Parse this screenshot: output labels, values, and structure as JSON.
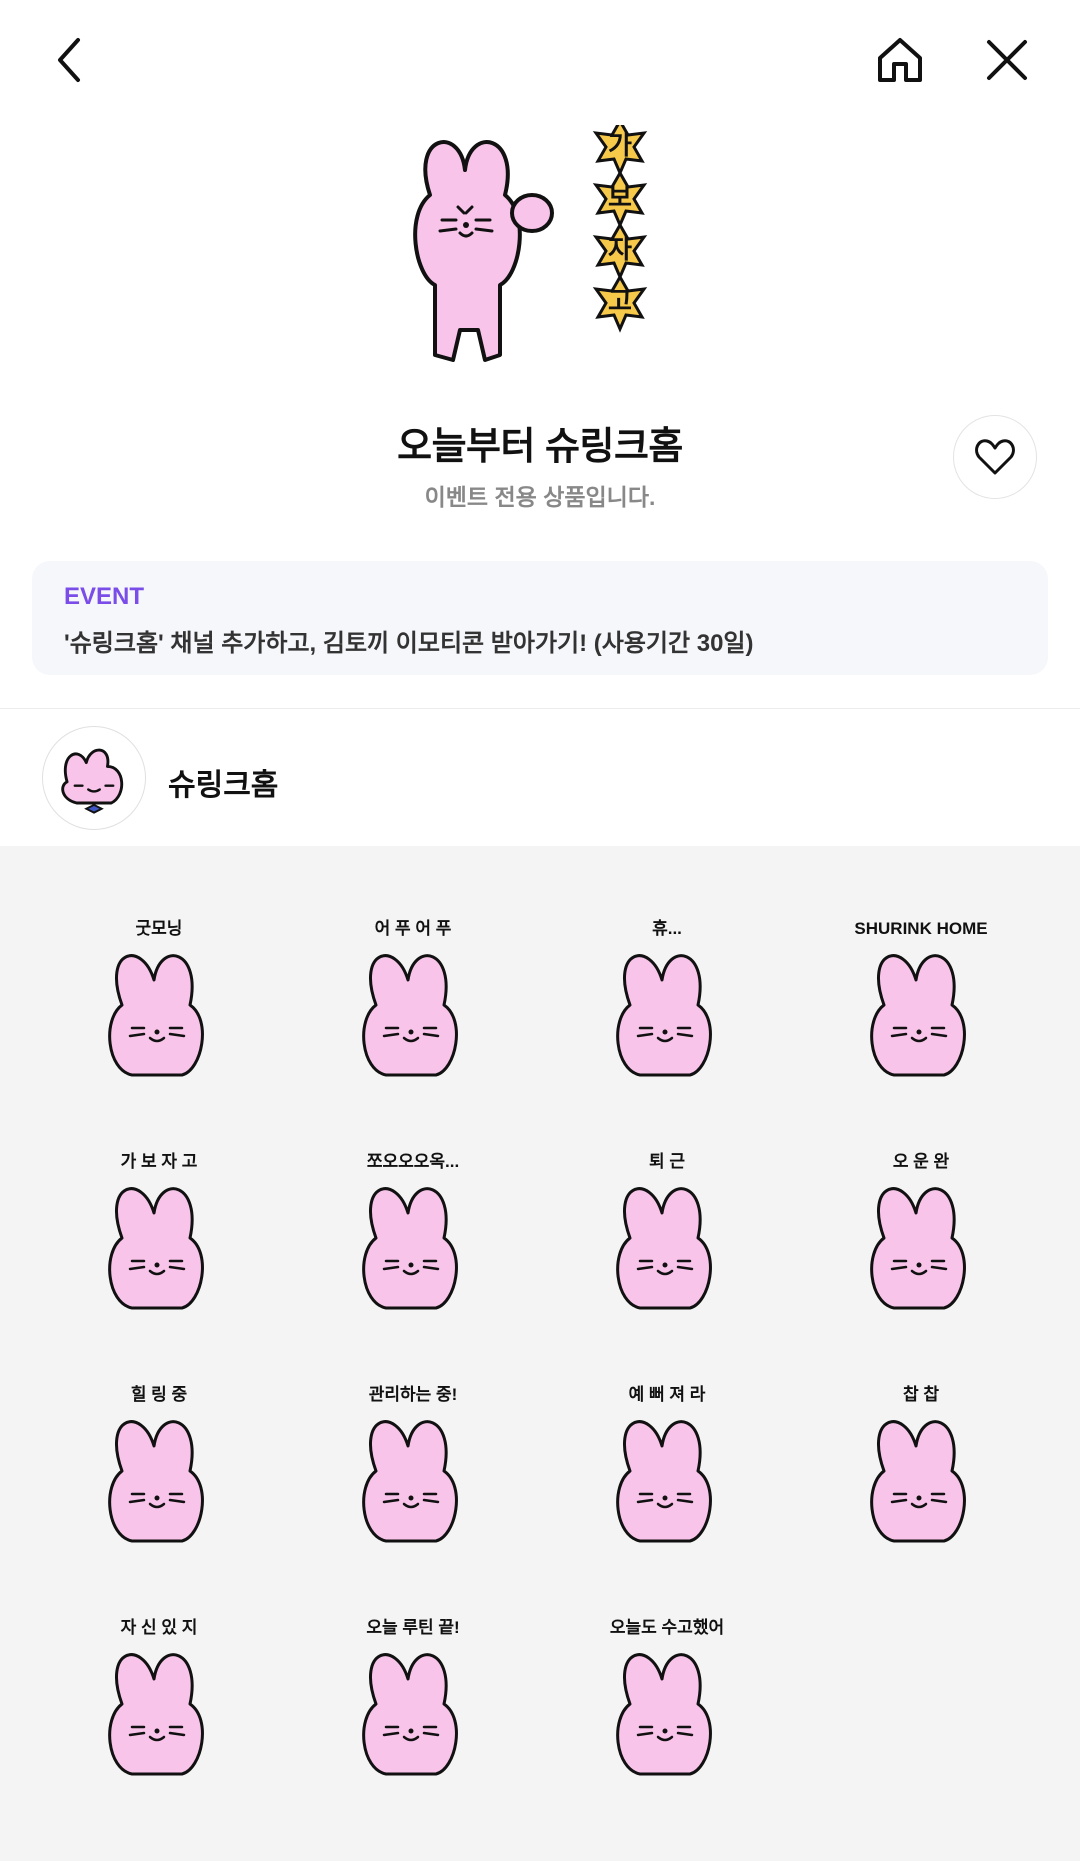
{
  "header": {
    "back_icon": "chevron-left-icon",
    "home_icon": "home-icon",
    "close_icon": "close-icon"
  },
  "product": {
    "title": "오늘부터 슈링크홈",
    "subtitle": "이벤트 전용 상품입니다.",
    "hero_caption": [
      "가",
      "보",
      "자",
      "고"
    ]
  },
  "event": {
    "tag": "EVENT",
    "text": "'슈링크홈' 채널 추가하고, 김토끼 이모티콘 받아가기! (사용기간 30일)"
  },
  "channel": {
    "name": "슈링크홈"
  },
  "stickers": [
    {
      "caption": "굿모닝"
    },
    {
      "caption": "어 푸 어 푸"
    },
    {
      "caption": "휴..."
    },
    {
      "caption": "SHURINK HOME"
    },
    {
      "caption": "가 보 자 고"
    },
    {
      "caption": "쪼오오오옥..."
    },
    {
      "caption": "퇴 근"
    },
    {
      "caption": "오 운 완"
    },
    {
      "caption": "힐 링 중"
    },
    {
      "caption": "관리하는 중!"
    },
    {
      "caption": "예 뻐 져 라"
    },
    {
      "caption": "찹 찹"
    },
    {
      "caption": "자 신 있 지"
    },
    {
      "caption": "오늘 루틴 끝!"
    },
    {
      "caption": "오늘도 수고했어"
    }
  ],
  "colors": {
    "bunny_pink": "#f9c4ea",
    "accent_purple": "#7a4de8",
    "star_yellow": "#f7c94a"
  }
}
